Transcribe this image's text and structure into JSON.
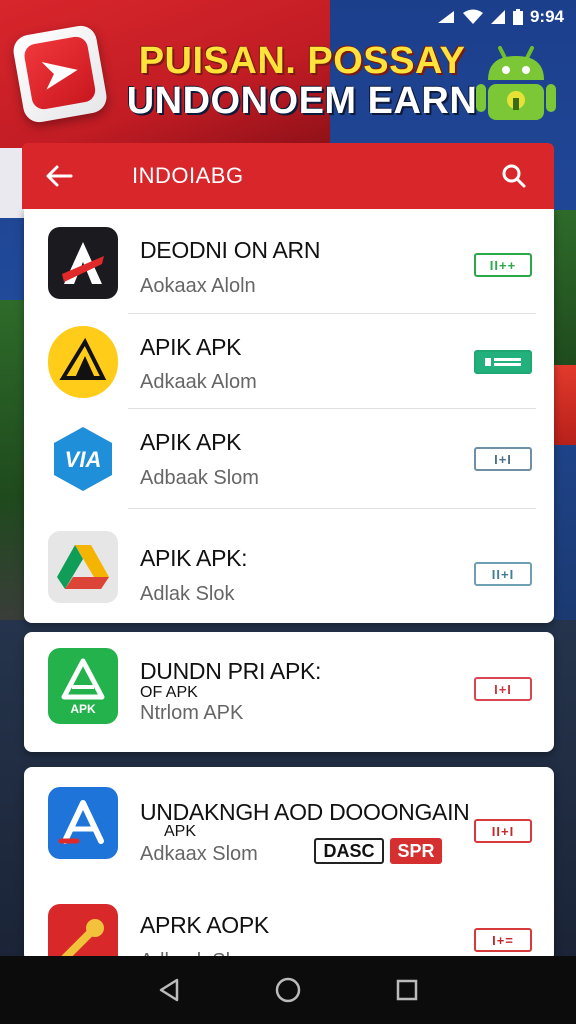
{
  "status_bar": {
    "time": "9:94"
  },
  "banner": {
    "line1": "PUISAN. POSSAY",
    "line2": "UNDONOEM EARN"
  },
  "app_bar": {
    "title": "INDOIABG"
  },
  "apps": [
    {
      "name": "DEODNI ON ARN",
      "subtitle": "Aokaax Aloln",
      "action": "II++",
      "action_color": "#2aa84a",
      "icon_bg": "#1b1b1f"
    },
    {
      "name": "APIK  APK",
      "subtitle": "Adkaak Alom",
      "action": "",
      "action_color": "#1fa774",
      "icon_bg": "#ffcc1a"
    },
    {
      "name": "APIK  APK",
      "subtitle": "Adbaak Slom",
      "action": "I+I",
      "action_color": "#6f8fa4",
      "icon_bg": "#ffffff"
    },
    {
      "name": "APIK  APK:",
      "subtitle": "Adlak Slok",
      "action": "II+I",
      "action_color": "#6f9fb4",
      "icon_bg": "#e6e6e6"
    }
  ],
  "featured_app": {
    "name": "DUNDN PRI APK:",
    "tag": "OF APK",
    "subtitle": "Ntrlom APK",
    "action": "I+I",
    "action_color": "#d9464f",
    "icon_bg": "#23b24b",
    "icon_text": "APK"
  },
  "more_apps": [
    {
      "name": "UNDAKNGH  AOD DOOONGAIN",
      "tag": "APK",
      "subtitle": "Adkaax Slom",
      "badge_outline": "DASC",
      "badge_filled": "SPR",
      "action": "II+I",
      "action_color": "#d63a3a",
      "icon_bg": "#1e74d8"
    },
    {
      "name": "APRK  AOPK",
      "subtitle": "Adkaak Slom",
      "action": "I+=",
      "action_color": "#d63a3a",
      "icon_bg": "#d8282a"
    }
  ],
  "icons": {
    "back": "arrow-left-icon",
    "search": "search-icon",
    "nav_back": "triangle-back-icon",
    "nav_home": "circle-home-icon",
    "nav_recents": "square-recents-icon"
  },
  "colors": {
    "app_bar": "#d9262b",
    "banner_yellow": "#ffe23a"
  }
}
